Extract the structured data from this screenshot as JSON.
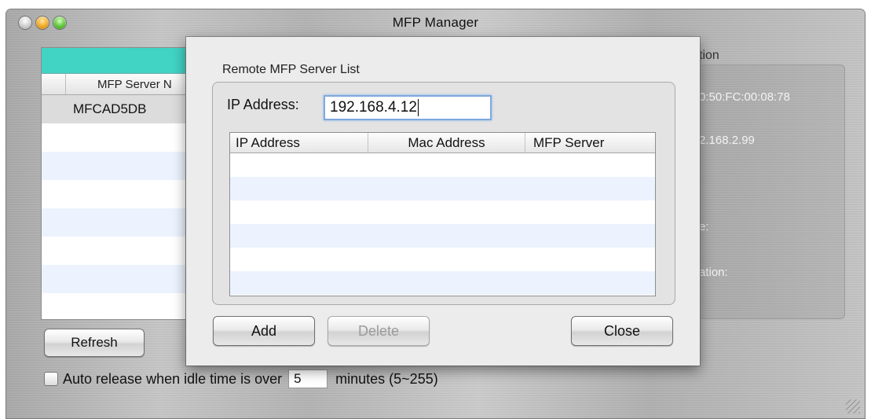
{
  "window": {
    "title": "MFP Manager"
  },
  "server_table": {
    "column_header": "MFP Server N",
    "rows": [
      "MFCAD5DB"
    ]
  },
  "info_panel": {
    "title": "tion",
    "mac_fragment": "0:50:FC:00:08:78",
    "ip_fragment": "2.168.2.99",
    "label_fragment_1": "e:",
    "label_fragment_2": "ation:"
  },
  "main_buttons": {
    "refresh_label": "Refresh"
  },
  "auto_release": {
    "label_before": "Auto release when idle time is over",
    "idle_value": "5",
    "label_after": "minutes (5~255)"
  },
  "sheet": {
    "group_title": "Remote MFP Server List",
    "ip_label": "IP Address:",
    "ip_value": "192.168.4.12",
    "columns": [
      "IP Address",
      "Mac Address",
      "MFP Server"
    ],
    "buttons": {
      "add": "Add",
      "delete": "Delete",
      "close": "Close"
    }
  },
  "icons": {
    "close": "close-light-icon",
    "minimize": "minimize-light-icon",
    "zoom": "zoom-light-icon",
    "resize": "resize-grip-icon"
  }
}
